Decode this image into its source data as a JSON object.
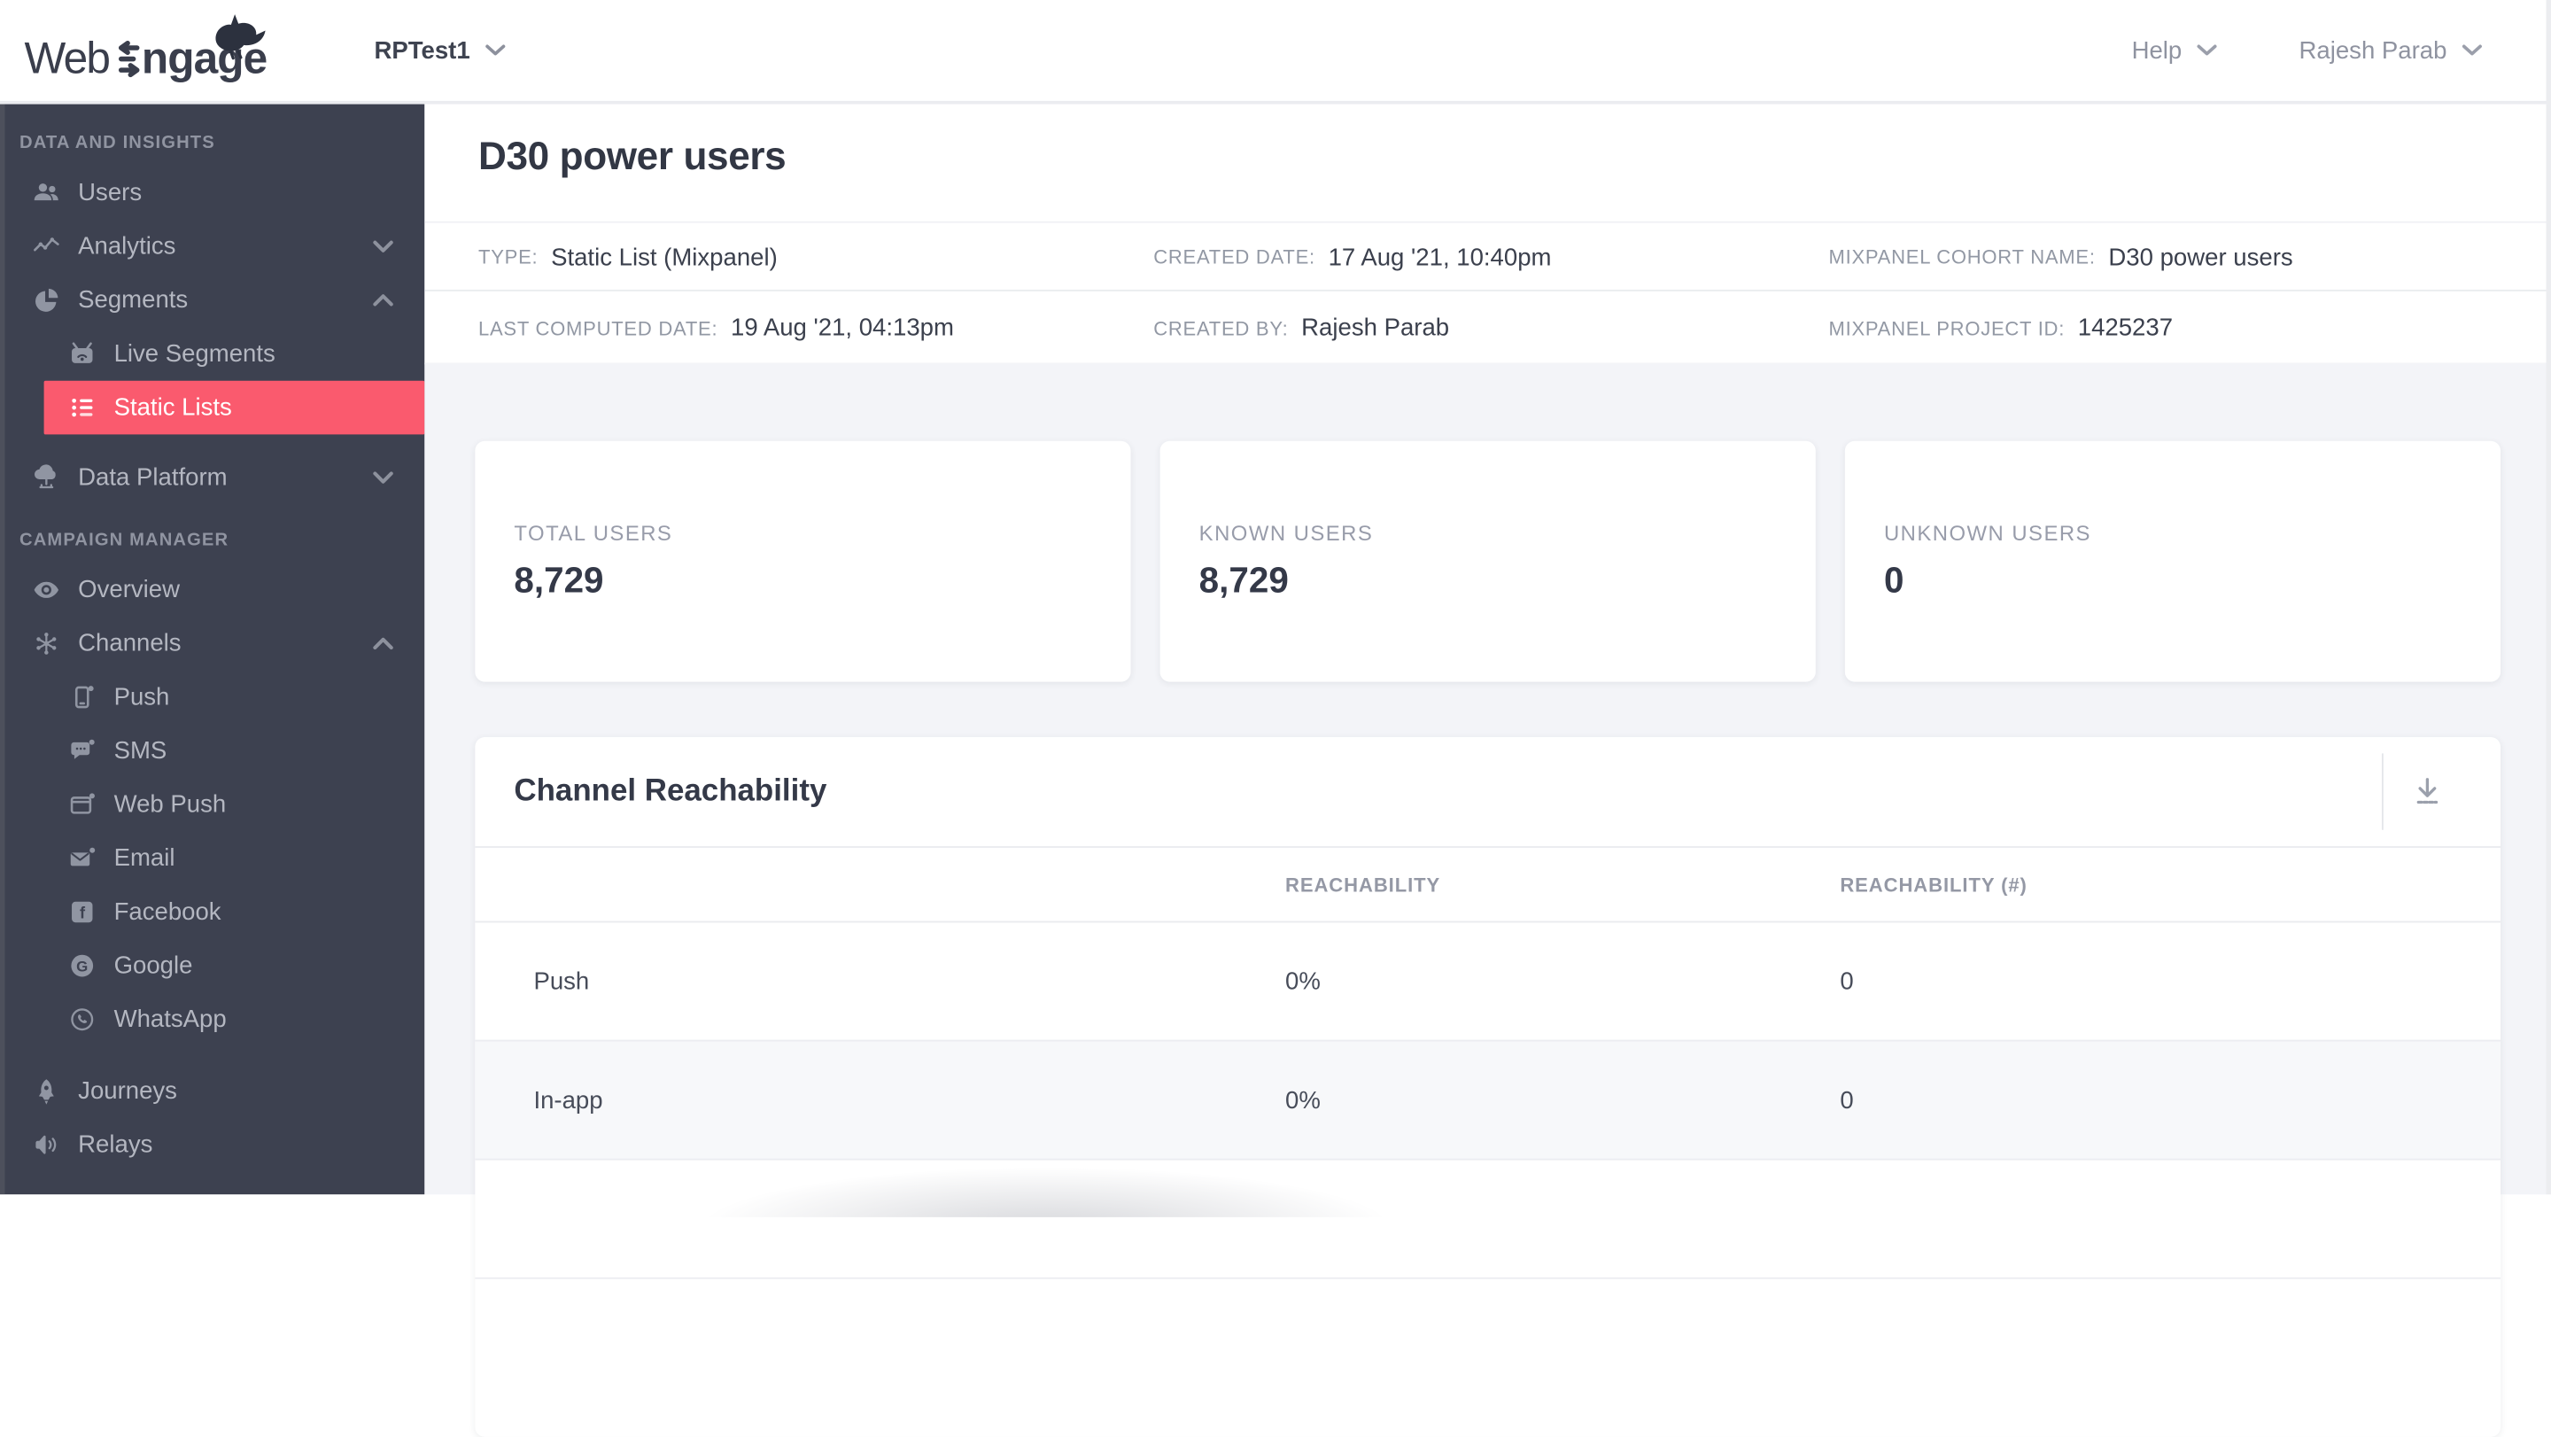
{
  "brand": {
    "logo_web": "Web",
    "logo_rest": "ngage"
  },
  "topnav": {
    "project": "RPTest1",
    "help": "Help",
    "user": "Rajesh Parab"
  },
  "colors": {
    "accent": "#fa5a6e",
    "sidebar_bg": "#3d4150"
  },
  "sidebar": {
    "headings": [
      "DATA AND INSIGHTS",
      "CAMPAIGN MANAGER"
    ],
    "items": [
      {
        "label": "Users"
      },
      {
        "label": "Analytics"
      },
      {
        "label": "Segments"
      },
      {
        "label": "Live Segments"
      },
      {
        "label": "Static Lists"
      },
      {
        "label": "Data Platform"
      },
      {
        "label": "Overview"
      },
      {
        "label": "Channels"
      },
      {
        "label": "Push"
      },
      {
        "label": "SMS"
      },
      {
        "label": "Web Push"
      },
      {
        "label": "Email"
      },
      {
        "label": "Facebook"
      },
      {
        "label": "Google"
      },
      {
        "label": "WhatsApp"
      },
      {
        "label": "Journeys"
      },
      {
        "label": "Relays"
      }
    ]
  },
  "page": {
    "title": "D30 power users",
    "meta": {
      "type_label": "TYPE:",
      "type_value": "Static List (Mixpanel)",
      "created_date_label": "CREATED DATE:",
      "created_date_value": "17 Aug '21, 10:40pm",
      "cohort_label": "MIXPANEL COHORT NAME:",
      "cohort_value": "D30 power users",
      "computed_label": "LAST COMPUTED DATE:",
      "computed_value": "19 Aug '21, 04:13pm",
      "created_by_label": "CREATED BY:",
      "created_by_value": "Rajesh Parab",
      "project_label": "MIXPANEL PROJECT ID:",
      "project_value": "1425237"
    },
    "cards": [
      {
        "label": "TOTAL USERS",
        "value": "8,729"
      },
      {
        "label": "KNOWN USERS",
        "value": "8,729"
      },
      {
        "label": "UNKNOWN USERS",
        "value": "0"
      }
    ],
    "reachability": {
      "title": "Channel Reachability",
      "columns": [
        "REACHABILITY",
        "REACHABILITY (#)"
      ],
      "rows": [
        {
          "channel": "Push",
          "reachability": "0%",
          "count": "0"
        },
        {
          "channel": "In-app",
          "reachability": "0%",
          "count": "0"
        }
      ]
    }
  }
}
